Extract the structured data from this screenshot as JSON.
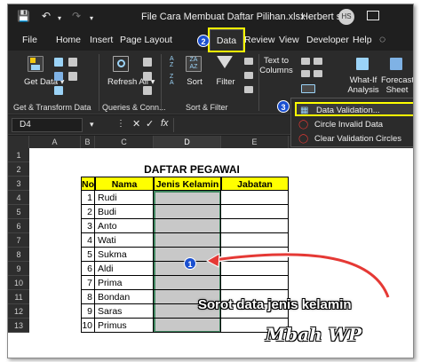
{
  "titlebar": {
    "filename": "File Cara Membuat Daftar Pilihan.xlsx - ...",
    "user": "Herbert s",
    "avatar_initials": "HS"
  },
  "menu": {
    "items": [
      "File",
      "Home",
      "Insert",
      "Page Layout",
      "Data",
      "Review",
      "View",
      "Developer",
      "Help"
    ],
    "active": "Data"
  },
  "ribbon": {
    "get_data": "Get Data",
    "refresh_all": "Refresh All",
    "sort": "Sort",
    "filter": "Filter",
    "text_to_columns": "Text to Columns",
    "what_if": "What-If Analysis",
    "forecast": "Forecast Sheet",
    "groups": {
      "get_transform": "Get & Transform Data",
      "queries": "Queries & Conn...",
      "sort_filter": "Sort & Filter"
    }
  },
  "validation_menu": {
    "items": [
      "Data Validation...",
      "Circle Invalid Data",
      "Clear Validation Circles"
    ]
  },
  "formula_bar": {
    "name_box": "D4",
    "fx": "fx"
  },
  "sheet": {
    "columns": [
      "A",
      "B",
      "C",
      "D",
      "E",
      "F"
    ],
    "rows": [
      "1",
      "2",
      "3",
      "4",
      "5",
      "6",
      "7",
      "8",
      "9",
      "10",
      "11",
      "12",
      "13"
    ],
    "title": "DAFTAR PEGAWAI",
    "headers": {
      "no": "No.",
      "nama": "Nama",
      "jenis_kelamin": "Jenis Kelamin",
      "jabatan": "Jabatan"
    },
    "employees": [
      {
        "no": "1",
        "nama": "Rudi"
      },
      {
        "no": "2",
        "nama": "Budi"
      },
      {
        "no": "3",
        "nama": "Anto"
      },
      {
        "no": "4",
        "nama": "Wati"
      },
      {
        "no": "5",
        "nama": "Sukma"
      },
      {
        "no": "6",
        "nama": "Aldi"
      },
      {
        "no": "7",
        "nama": "Prima"
      },
      {
        "no": "8",
        "nama": "Bondan"
      },
      {
        "no": "9",
        "nama": "Saras"
      },
      {
        "no": "10",
        "nama": "Primus"
      }
    ]
  },
  "annotations": {
    "step1": "1",
    "step2": "2",
    "step3": "3",
    "caption": "Sorot data jenis kelamin",
    "watermark": "Mbah WP"
  },
  "colors": {
    "accent_yellow": "#ffff00",
    "selection_gray": "#bfbfbf",
    "selection_border": "#217346",
    "arrow_red": "#e53935",
    "badge_blue": "#1a4fd0"
  }
}
